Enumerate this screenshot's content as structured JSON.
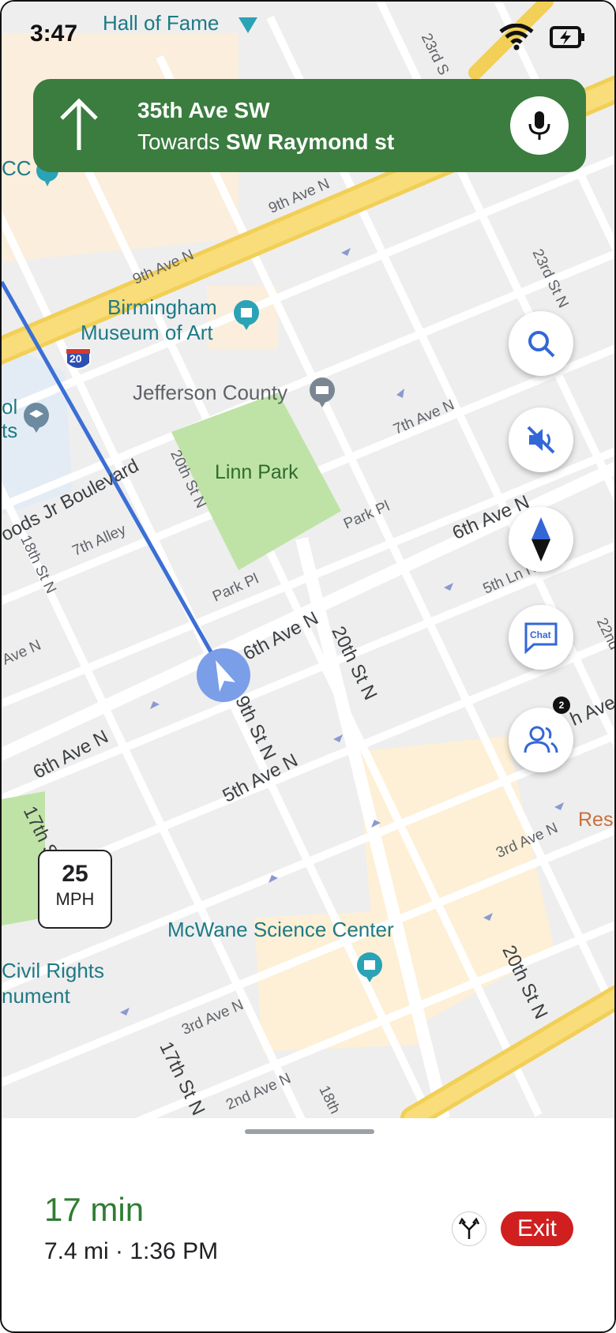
{
  "status_bar": {
    "time": "3:47",
    "icons": [
      "wifi-icon",
      "battery-charging-icon"
    ]
  },
  "navigation": {
    "street": "35th Ave SW",
    "towards_prefix": "Towards",
    "towards_street": "SW Raymond st",
    "maneuver_icon": "straight-arrow-icon",
    "accent_color": "#3a7d3f"
  },
  "map": {
    "pois": {
      "hall_of_fame": "Hall of Fame",
      "museum_line1": "Birmingham",
      "museum_line2": "Museum of Art",
      "jefferson": "Jefferson County",
      "linn_park": "Linn Park",
      "mcwane": "McWane Science Center",
      "civil_line1": "Civil Rights",
      "civil_line2": "nument",
      "cc": "CC",
      "ol": "ol",
      "ts": "ts",
      "rest": "Res"
    },
    "streets": {
      "s_9th_top": "9th Ave N",
      "s_9th_mid": "9th Ave N",
      "s_23rd_top": "23rd S",
      "s_23rd": "23rd St N",
      "s_7th_ave": "7th Ave N",
      "s_6th_right": "6th Ave N",
      "s_5th_ln": "5th Ln N",
      "s_22nd": "22nd",
      "s_park_pl_r": "Park Pl",
      "s_park_pl_l": "Park Pl",
      "s_20th_park": "20th St N",
      "s_boulevard": "oods Jr Boulevard",
      "s_7th_alley": "7th Alley",
      "s_18th": "18th St N",
      "s_ave_n_left": "Ave N",
      "s_6th_center": "6th Ave N",
      "s_19th": "19th St N",
      "s_20th_center": "20th St N",
      "s_h_ave": "h Ave N",
      "s_6th_left": "6th Ave N",
      "s_5th_ave": "5th Ave N",
      "s_17th_top": "17th S",
      "s_3rd_right": "3rd Ave N",
      "s_3rd_left": "3rd Ave N",
      "s_17th_bottom": "17th St N",
      "s_2nd": "2nd Ave N",
      "s_18th_bottom": "18th",
      "s_20th_bottom": "20th St N"
    },
    "highway_shield": "20",
    "route_color": "#3b6fd6"
  },
  "speed_limit": {
    "value": "25",
    "unit": "MPH"
  },
  "side_buttons": {
    "chat_label": "Chat",
    "people_badge": "2"
  },
  "trip": {
    "eta": "17 min",
    "details": "7.4 mi · 1:36 PM",
    "exit_label": "Exit",
    "eta_color": "#2e7d32",
    "exit_color": "#d01f1f"
  }
}
